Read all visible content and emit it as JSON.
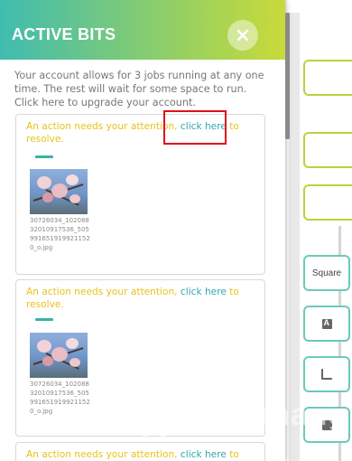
{
  "panel": {
    "title": "ACTIVE BITS",
    "close_label": "×",
    "info_text": "Your account allows for 3 jobs running at any one time. The rest will wait for some space to run. Click here to upgrade your account."
  },
  "cards": [
    {
      "message_prefix": "An action needs your attention,",
      "link_text": "click here",
      "message_suffix": "to resolve.",
      "filename": "30726034_10208832010917536_5059916519199211520_o.jpg"
    },
    {
      "message_prefix": "An action needs your attention,",
      "link_text": "click here",
      "message_suffix": "to resolve.",
      "filename": "30726034_10208832010917536_5059916519199211520_o.jpg"
    },
    {
      "message_prefix": "An action needs your attention,",
      "link_text": "click here",
      "message_suffix": "to"
    }
  ],
  "background_tools": {
    "square_label": "Square",
    "icons": [
      "text-icon",
      "crop-icon",
      "save-icon"
    ]
  },
  "colors": {
    "header_start": "#3fbcb0",
    "header_end": "#c9da3a",
    "message": "#e8c21a",
    "link": "#2fa9b1",
    "highlight": "#e0101a"
  },
  "watermark": "uantrimang"
}
